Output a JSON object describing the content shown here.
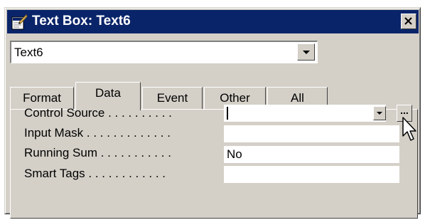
{
  "window": {
    "title": "Text Box: Text6",
    "object_selector_value": "Text6",
    "close_symbol": "✕"
  },
  "tabs": [
    {
      "label": "Format",
      "active": false
    },
    {
      "label": "Data",
      "active": true
    },
    {
      "label": "Event",
      "active": false
    },
    {
      "label": "Other",
      "active": false
    },
    {
      "label": "All",
      "active": false
    }
  ],
  "properties": [
    {
      "label": "Control Source . . . . . . . . . .",
      "value": ""
    },
    {
      "label": "Input Mask . . . . . . . . . . . . .",
      "value": ""
    },
    {
      "label": "Running Sum . . . . . . . . . . .",
      "value": "No"
    },
    {
      "label": "Smart Tags . . . . . . . . . . . .",
      "value": ""
    }
  ],
  "build_button_label": "...",
  "icons": {
    "title": "properties-icon",
    "close": "close-icon",
    "dropdown": "chevron-down-icon",
    "build": "ellipsis-icon",
    "cursor": "mouse-pointer-icon"
  },
  "colors": {
    "titlebar": "#0a246a",
    "face": "#d4d0c8",
    "field": "#ffffff"
  }
}
